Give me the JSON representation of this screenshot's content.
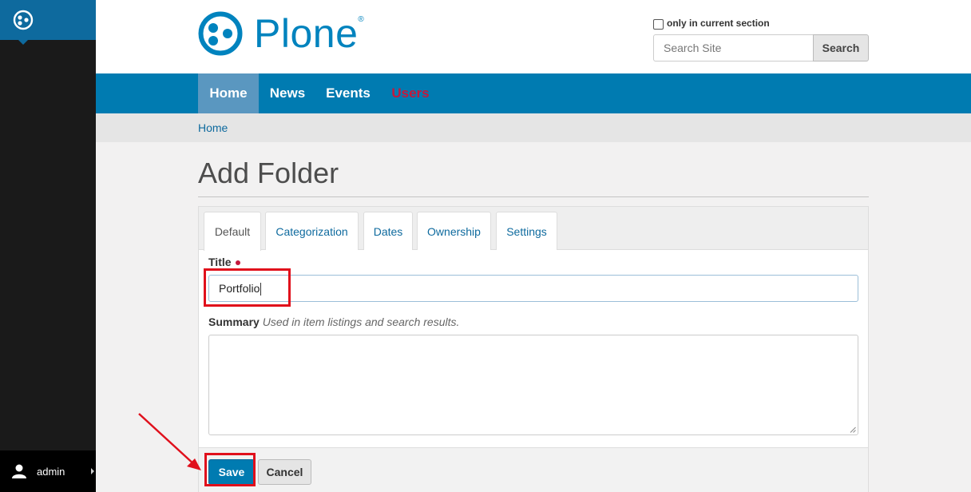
{
  "toolbar": {
    "logo_icon": "plone-logo-icon",
    "user": {
      "icon": "user-icon",
      "name": "admin"
    }
  },
  "header": {
    "logo_text": "Plone",
    "logo_reg": "®",
    "section_only_label": "only in current section",
    "search_placeholder": "Search Site",
    "search_button": "Search"
  },
  "nav": {
    "items": [
      {
        "label": "Home",
        "active": true
      },
      {
        "label": "News"
      },
      {
        "label": "Events"
      },
      {
        "label": "Users",
        "color": "#c4183c"
      }
    ]
  },
  "breadcrumb": {
    "home": "Home"
  },
  "page": {
    "title": "Add Folder"
  },
  "tabs": [
    "Default",
    "Categorization",
    "Dates",
    "Ownership",
    "Settings"
  ],
  "form": {
    "title_label": "Title",
    "title_value": "Portfolio",
    "summary_label": "Summary",
    "summary_help": "Used in item listings and search results.",
    "summary_value": ""
  },
  "buttons": {
    "save": "Save",
    "cancel": "Cancel"
  },
  "colors": {
    "brand": "#0083be",
    "nav": "#007bb1",
    "required": "#c4183c",
    "annotation": "#e0101c"
  }
}
